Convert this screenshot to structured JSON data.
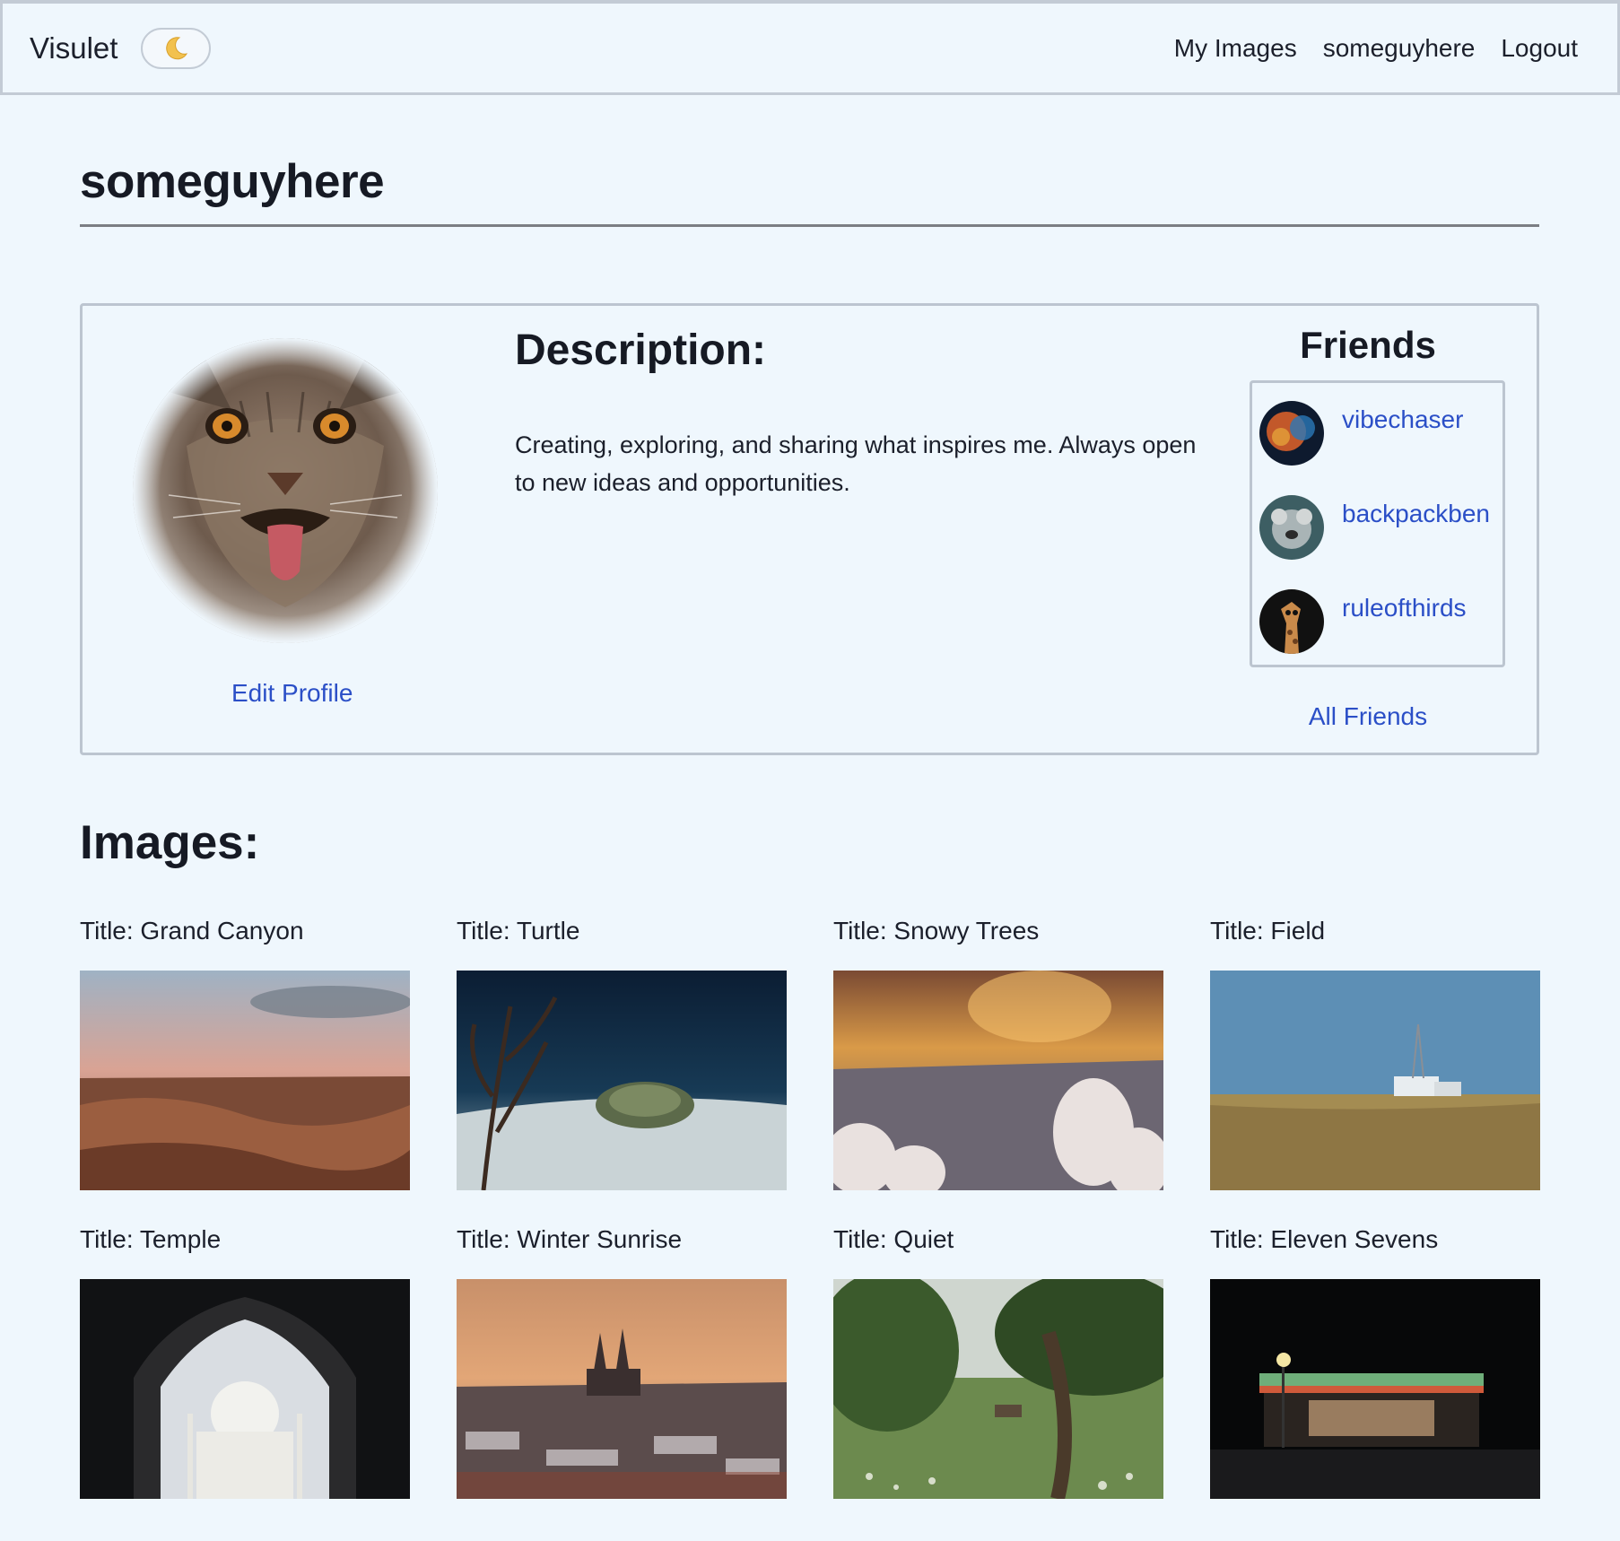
{
  "nav": {
    "brand": "Visulet",
    "theme_toggle_icon": "moon-icon",
    "links": {
      "my_images": "My Images",
      "username": "someguyhere",
      "logout": "Logout"
    }
  },
  "profile": {
    "username": "someguyhere",
    "edit_label": "Edit Profile",
    "description_heading": "Description:",
    "description": "Creating, exploring, and sharing what inspires me. Always open to new ideas and opportunities.",
    "friends_heading": "Friends",
    "friends": [
      {
        "name": "vibechaser"
      },
      {
        "name": "backpackben"
      },
      {
        "name": "ruleofthirds"
      }
    ],
    "all_friends_label": "All Friends"
  },
  "images": {
    "heading": "Images:",
    "items": [
      {
        "title": "Title: Grand Canyon"
      },
      {
        "title": "Title: Turtle"
      },
      {
        "title": "Title: Snowy Trees"
      },
      {
        "title": "Title: Field"
      },
      {
        "title": "Title: Temple"
      },
      {
        "title": "Title: Winter Sunrise"
      },
      {
        "title": "Title: Quiet"
      },
      {
        "title": "Title: Eleven Sevens"
      }
    ]
  }
}
